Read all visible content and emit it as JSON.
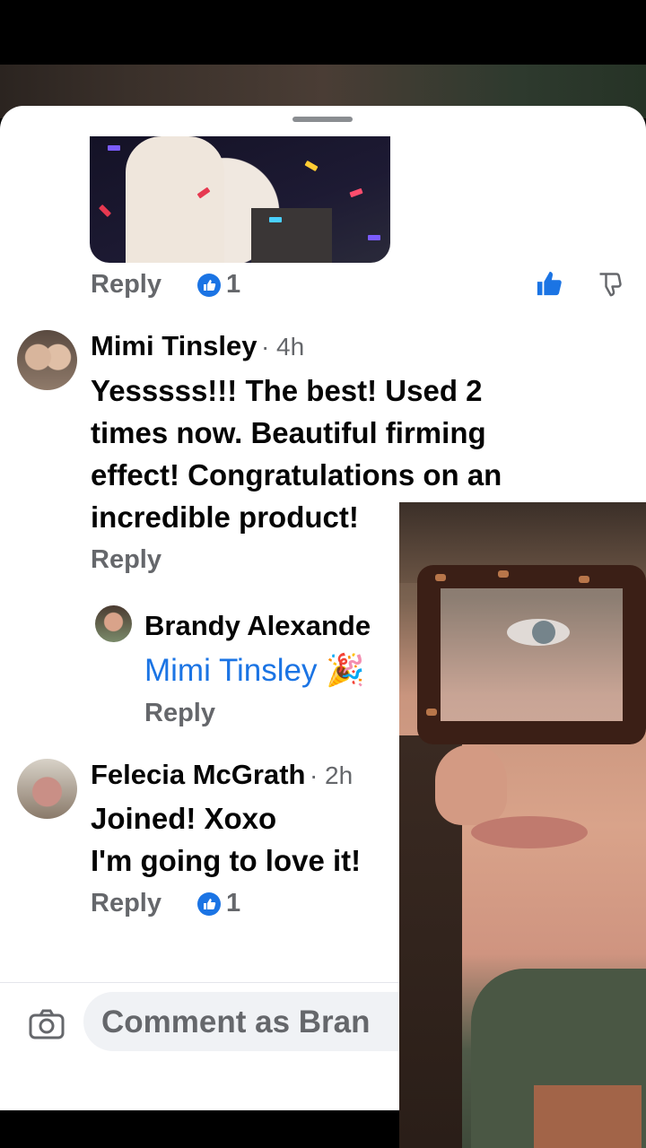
{
  "thread": {
    "top_actions": {
      "reply_label": "Reply",
      "like_count": "1"
    },
    "comments": [
      {
        "name": "Mimi Tinsley",
        "time": "· 4h",
        "text_lines": [
          "Yesssss!!! The best! Used 2",
          "times now. Beautiful firming",
          "effect! Congratulations on an",
          "incredible product!"
        ],
        "reply_label": "Reply"
      },
      {
        "name": "Brandy Alexande",
        "mention": "Mimi Tinsley",
        "emoji": "🎉",
        "reply_label": "Reply"
      },
      {
        "name": "Felecia McGrath",
        "time": "· 2h",
        "text_lines": [
          "Joined! Xoxo",
          "I'm going to love it!"
        ],
        "reply_label": "Reply",
        "like_count": "1"
      }
    ]
  },
  "composer": {
    "placeholder": "Comment as Bran"
  },
  "icons": {
    "like": "thumbs-up-icon",
    "dislike": "thumbs-down-icon",
    "camera": "camera-icon"
  },
  "colors": {
    "accent": "#1b74e4",
    "secondary_text": "#65676b"
  }
}
